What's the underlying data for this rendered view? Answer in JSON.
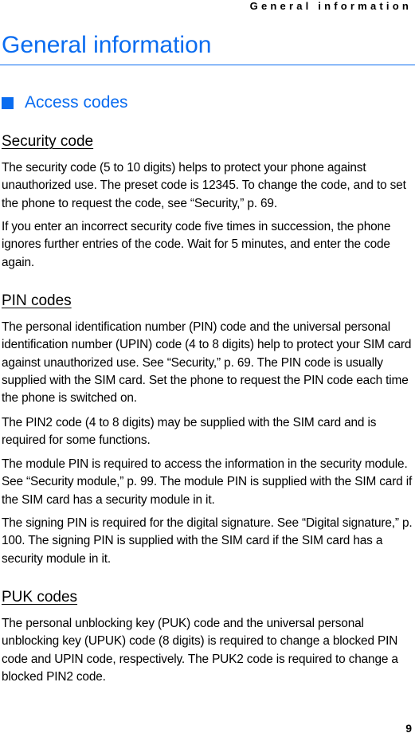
{
  "running_head": "General information",
  "page_title": "General information",
  "section": {
    "icon": "filled-square-icon",
    "title": "Access codes"
  },
  "subsections": [
    {
      "title": "Security code",
      "paragraphs": [
        "The security code (5 to 10 digits) helps to protect your phone against unauthorized use. The preset code is 12345. To change the code, and to set the phone to request the code, see “Security,” p. 69.",
        "If you enter an incorrect security code five times in succession, the phone ignores further entries of the code. Wait for 5 minutes, and enter the code again."
      ]
    },
    {
      "title": "PIN codes",
      "paragraphs": [
        "The personal identification number (PIN) code and the universal personal identification number (UPIN) code (4 to 8 digits) help to protect your SIM card against unauthorized use. See “Security,” p. 69. The PIN code is usually supplied with the SIM card. Set the phone to request the PIN code each time the phone is switched on.",
        "The PIN2 code (4 to 8 digits) may be supplied with the SIM card and is required for some functions.",
        "The module PIN is required to access the information in the security module. See “Security module,” p. 99. The module PIN is supplied with the SIM card if the SIM card has a security module in it.",
        "The signing PIN is required for the digital signature. See “Digital signature,” p. 100. The signing PIN is supplied with the SIM card if the SIM card has a security module in it."
      ]
    },
    {
      "title": "PUK codes",
      "paragraphs": [
        "The personal unblocking key (PUK) code and the universal personal unblocking key (UPUK) code (8 digits) is required to change a blocked PIN code and UPIN code, respectively. The PUK2 code is required to change a blocked PIN2 code."
      ]
    }
  ],
  "page_number": "9",
  "colors": {
    "accent": "#0a6cf0",
    "text": "#000000"
  }
}
